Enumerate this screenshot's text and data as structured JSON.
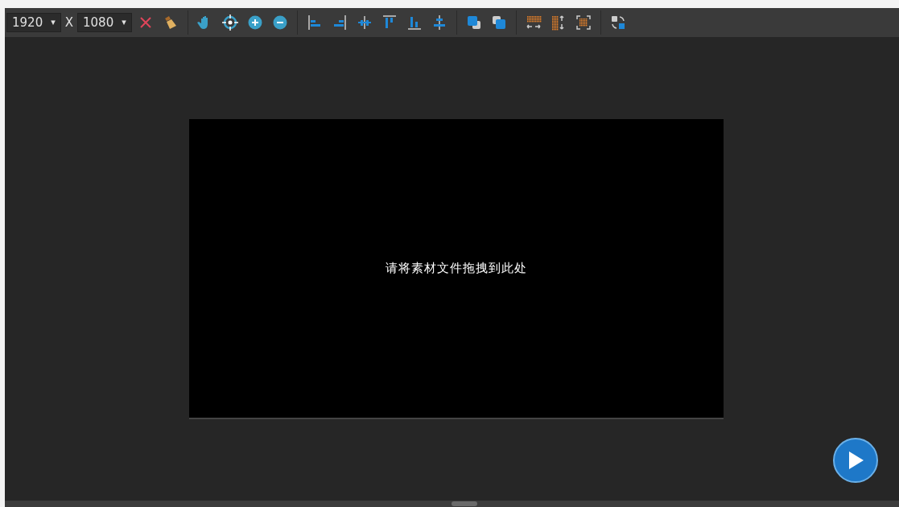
{
  "toolbar": {
    "width": {
      "value": "1920",
      "icon": "▾"
    },
    "separator": "X",
    "height": {
      "value": "1080",
      "icon": "▾"
    }
  },
  "canvas": {
    "hint": "请将素材文件拖拽到此处"
  }
}
